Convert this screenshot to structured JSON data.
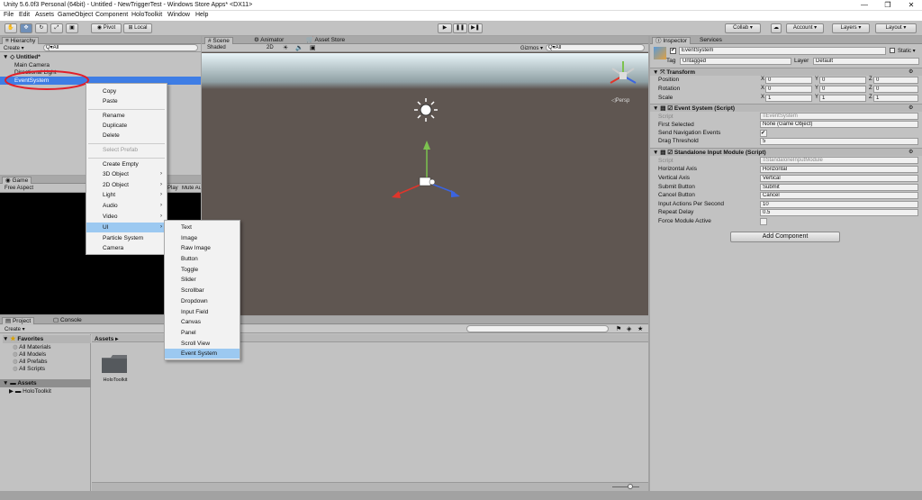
{
  "titlebar": {
    "title": "Unity 5.6.0f3 Personal (64bit) - Untitled - NewTriggerTest - Windows Store Apps* <DX11>",
    "minimize": "—",
    "maximize": "❐",
    "close": "✕"
  },
  "menubar": [
    "File",
    "Edit",
    "Assets",
    "GameObject",
    "Component",
    "HoloToolkit",
    "Window",
    "Help"
  ],
  "toolbar": {
    "pivot": "Pivot",
    "local": "Local",
    "collab": "Collab ▾",
    "account": "Account ▾",
    "layers": "Layers ▾",
    "layout": "Layout ▾",
    "cloud_icon": "cloud-icon"
  },
  "hierarchy": {
    "tab": "Hierarchy",
    "create": "Create ▾",
    "search_placeholder": "Q▾All",
    "scene": "Untitled*",
    "items": [
      "Main Camera",
      "Directional Light",
      "EventSystem"
    ]
  },
  "context_menu": {
    "items": [
      "Copy",
      "Paste",
      "Rename",
      "Duplicate",
      "Delete",
      "Select Prefab",
      "Create Empty",
      "3D Object",
      "2D Object",
      "Light",
      "Audio",
      "Video",
      "UI",
      "Particle System",
      "Camera"
    ],
    "arrow": "›"
  },
  "ui_submenu": {
    "items": [
      "Text",
      "Image",
      "Raw Image",
      "Button",
      "Toggle",
      "Slider",
      "Scrollbar",
      "Dropdown",
      "Input Field",
      "Canvas",
      "Panel",
      "Scroll View",
      "Event System"
    ]
  },
  "game": {
    "tab": "Game",
    "aspect": "Free Aspect",
    "play_label": "Play",
    "mute_label": "Mute Aud"
  },
  "scene": {
    "tabs": [
      "Scene",
      "Animator",
      "Asset Store"
    ],
    "shading": "Shaded",
    "mode2d": "2D",
    "gizmos": "Gizmos ▾",
    "search_placeholder": "Q▾All",
    "persp": "◁Persp"
  },
  "project": {
    "tabs": [
      "Project",
      "Console"
    ],
    "create": "Create ▾",
    "favorites": "Favorites",
    "fav_items": [
      "All Materials",
      "All Models",
      "All Prefabs",
      "All Scripts"
    ],
    "assets": "Assets",
    "asset_tree": [
      "HoloToolkit"
    ],
    "breadcrumb": "Assets ▸",
    "folder_name": "HoloToolkit"
  },
  "inspector": {
    "tabs": [
      "Inspector",
      "Services"
    ],
    "object_name": "EventSystem",
    "static_label": "Static ▾",
    "tag_label": "Tag",
    "tag_value": "Untagged",
    "layer_label": "Layer",
    "layer_value": "Default",
    "transform": {
      "title": "Transform",
      "rows": [
        {
          "label": "Position",
          "x": "0",
          "y": "0",
          "z": "0"
        },
        {
          "label": "Rotation",
          "x": "0",
          "y": "0",
          "z": "0"
        },
        {
          "label": "Scale",
          "x": "1",
          "y": "1",
          "z": "1"
        }
      ]
    },
    "event_system": {
      "title": "Event System (Script)",
      "rows": [
        {
          "label": "Script",
          "value": "≡EventSystem"
        },
        {
          "label": "First Selected",
          "value": "None (Game Object)"
        },
        {
          "label": "Send Navigation Events",
          "value": "✔"
        },
        {
          "label": "Drag Threshold",
          "value": "5"
        }
      ]
    },
    "input_module": {
      "title": "Standalone Input Module (Script)",
      "rows": [
        {
          "label": "Script",
          "value": "≡StandaloneInputModule"
        },
        {
          "label": "Horizontal Axis",
          "value": "Horizontal"
        },
        {
          "label": "Vertical Axis",
          "value": "Vertical"
        },
        {
          "label": "Submit Button",
          "value": "Submit"
        },
        {
          "label": "Cancel Button",
          "value": "Cancel"
        },
        {
          "label": "Input Actions Per Second",
          "value": "10"
        },
        {
          "label": "Repeat Delay",
          "value": "0.5"
        },
        {
          "label": "Force Module Active",
          "value": ""
        }
      ]
    },
    "add_component": "Add Component"
  },
  "colors": {
    "selection": "#3e7de5",
    "menu_highlight": "#9cc9f1",
    "scene_ground": "#5f5651",
    "annotation": "#e11f2a"
  }
}
